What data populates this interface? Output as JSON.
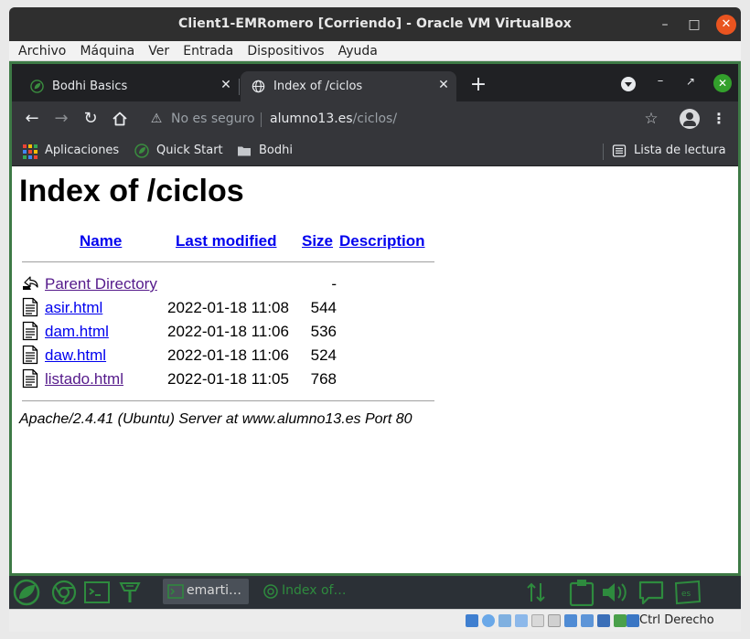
{
  "vbox": {
    "title": "Client1-EMRomero [Corriendo] - Oracle VM VirtualBox",
    "menu": [
      "Archivo",
      "Máquina",
      "Ver",
      "Entrada",
      "Dispositivos",
      "Ayuda"
    ],
    "host_key": "Ctrl Derecho"
  },
  "browser": {
    "tabs": [
      {
        "title": "Bodhi Basics",
        "active": false
      },
      {
        "title": "Index of /ciclos",
        "active": true
      }
    ],
    "security_label": "No es seguro",
    "url_host": "alumno13.es",
    "url_path": "/ciclos/",
    "bookmarks": [
      "Aplicaciones",
      "Quick Start",
      "Bodhi"
    ],
    "reading_list": "Lista de lectura",
    "icons": {
      "back": "back-arrow-icon",
      "forward": "forward-arrow-icon",
      "reload": "reload-icon",
      "home": "home-icon",
      "star": "star-icon",
      "profile": "profile-icon",
      "menu": "kebab-menu-icon"
    }
  },
  "page": {
    "title": "Index of /ciclos",
    "columns": [
      "Name",
      "Last modified",
      "Size",
      "Description"
    ],
    "rows": [
      {
        "name": "Parent Directory",
        "modified": "",
        "size": "-",
        "icon": "back-folder-icon",
        "visited": true
      },
      {
        "name": "asir.html",
        "modified": "2022-01-18 11:08",
        "size": "544",
        "icon": "text-file-icon",
        "visited": false
      },
      {
        "name": "dam.html",
        "modified": "2022-01-18 11:06",
        "size": "536",
        "icon": "text-file-icon",
        "visited": false
      },
      {
        "name": "daw.html",
        "modified": "2022-01-18 11:06",
        "size": "524",
        "icon": "text-file-icon",
        "visited": false
      },
      {
        "name": "listado.html",
        "modified": "2022-01-18 11:05",
        "size": "768",
        "icon": "text-file-icon",
        "visited": true
      }
    ],
    "address": "Apache/2.4.41 (Ubuntu) Server at www.alumno13.es Port 80"
  },
  "guest_panel": {
    "tasks": [
      "emarti…",
      "Index of…"
    ]
  },
  "colors": {
    "vbox_close": "#e95420",
    "vm_border": "#3e7a46",
    "link": "#0000ee",
    "visited_link": "#551a8b",
    "chrome_dark": "#202124",
    "chrome_toolbar": "#35363a",
    "bodhi_green": "#2e8b3e"
  }
}
